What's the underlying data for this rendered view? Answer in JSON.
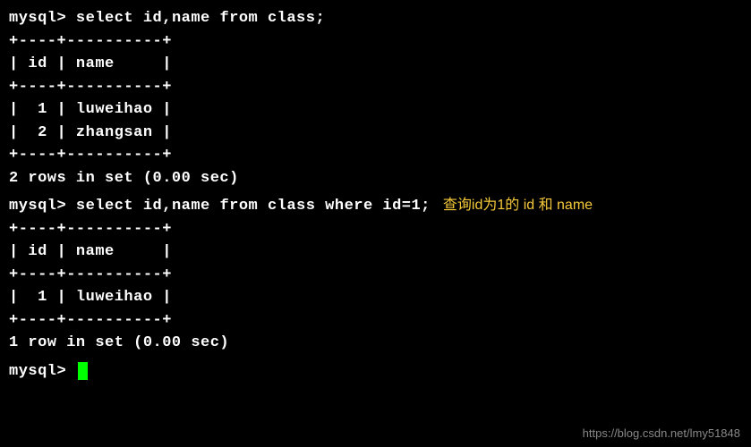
{
  "prompt": "mysql>",
  "query1": {
    "command": "select id,name from class;",
    "border": "+----+----------+",
    "header": "| id | name     |",
    "rows": [
      "|  1 | luweihao |",
      "|  2 | zhangsan |"
    ],
    "status": "2 rows in set (0.00 sec)"
  },
  "query2": {
    "command": "select id,name from class where id=1;",
    "annotation": "查询id为1的 id 和 name",
    "border": "+----+----------+",
    "header": "| id | name     |",
    "rows": [
      "|  1 | luweihao |"
    ],
    "status": "1 row in set (0.00 sec)"
  },
  "watermark": "https://blog.csdn.net/lmy51848"
}
